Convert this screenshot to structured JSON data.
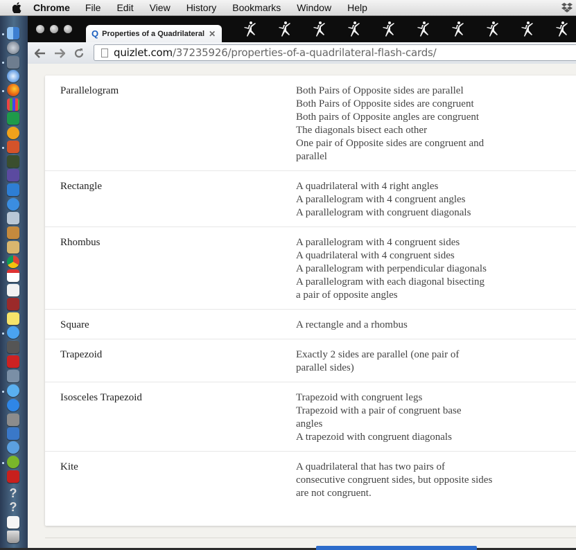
{
  "menubar": {
    "app": "Chrome",
    "items": [
      "File",
      "Edit",
      "View",
      "History",
      "Bookmarks",
      "Window",
      "Help"
    ]
  },
  "browser": {
    "tab_title": "Properties of a Quadrilateral",
    "tab_favicon": "Q",
    "url_domain": "quizlet.com",
    "url_path": "/37235926/properties-of-a-quadrilateral-flash-cards/"
  },
  "colors": {
    "accent": "#2d6ccb",
    "page_bg": "#f3f2ee",
    "card_bg": "#ffffff"
  },
  "terms": [
    {
      "term": "Parallelogram",
      "definition": [
        "Both Pairs of Opposite sides are parallel",
        "Both Pairs of Opposite sides are congruent",
        "Both pairs of Opposite angles are congruent",
        "The diagonals bisect each other",
        "One pair of Opposite sides are congruent and",
        "parallel"
      ]
    },
    {
      "term": "Rectangle",
      "definition": [
        "A quadrilateral with 4 right angles",
        "A parallelogram with 4 congruent angles",
        "A parallelogram with congruent diagonals"
      ]
    },
    {
      "term": "Rhombus",
      "definition": [
        "A parallelogram with 4 congruent sides",
        "A quadrilateral with 4 congruent sides",
        "A parallelogram with perpendicular diagonals",
        "A parallelogram with each diagonal bisecting",
        "a pair of opposite angles"
      ]
    },
    {
      "term": "Square",
      "definition": [
        "A rectangle and a rhombus"
      ]
    },
    {
      "term": "Trapezoid",
      "definition": [
        "Exactly 2 sides are parallel (one pair of",
        "parallel sides)"
      ]
    },
    {
      "term": "Isosceles Trapezoid",
      "definition": [
        "Trapezoid with congruent legs",
        "Trapezoid with a pair of congruent base",
        "angles",
        "A trapezoid with congruent diagonals"
      ]
    },
    {
      "term": "Kite",
      "definition": [
        "A quadrilateral that has two pairs of",
        "consecutive congruent sides, but opposite sides",
        "are not congruent."
      ]
    }
  ]
}
